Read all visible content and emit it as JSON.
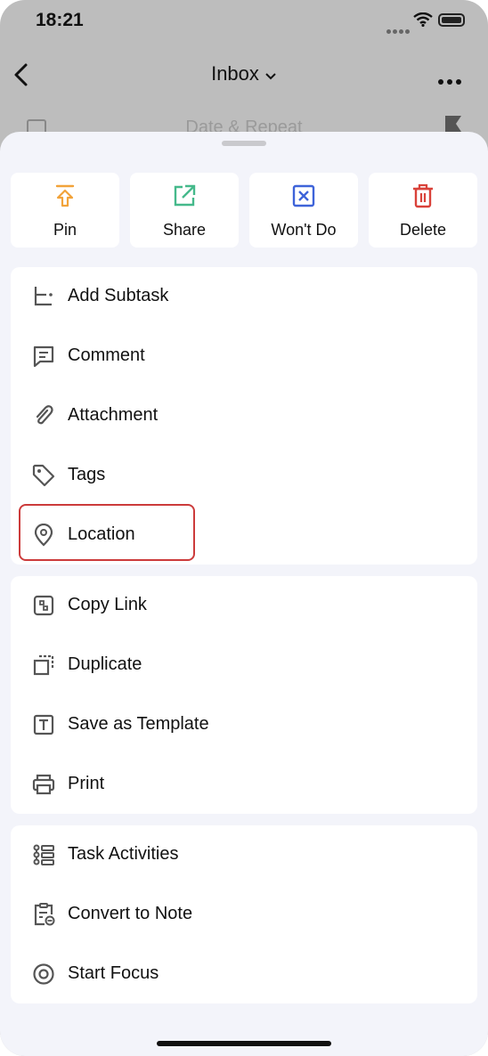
{
  "status_bar": {
    "time": "18:21"
  },
  "nav": {
    "title": "Inbox"
  },
  "background": {
    "row_text": "Date & Repeat"
  },
  "colors": {
    "pin": "#f2a33a",
    "share": "#45b98b",
    "wont_do": "#3e63d9",
    "delete": "#d9423a",
    "highlight": "#cc3b3b"
  },
  "actions": [
    {
      "label": "Pin",
      "icon": "pin-icon"
    },
    {
      "label": "Share",
      "icon": "share-icon"
    },
    {
      "label": "Won't Do",
      "icon": "wont-do-icon"
    },
    {
      "label": "Delete",
      "icon": "trash-icon"
    }
  ],
  "group1": [
    {
      "label": "Add Subtask",
      "icon": "subtask-icon"
    },
    {
      "label": "Comment",
      "icon": "comment-icon"
    },
    {
      "label": "Attachment",
      "icon": "paperclip-icon"
    },
    {
      "label": "Tags",
      "icon": "tag-icon"
    },
    {
      "label": "Location",
      "icon": "location-pin-icon"
    }
  ],
  "group2": [
    {
      "label": "Copy Link",
      "icon": "link-icon"
    },
    {
      "label": "Duplicate",
      "icon": "duplicate-icon"
    },
    {
      "label": "Save as Template",
      "icon": "template-icon"
    },
    {
      "label": "Print",
      "icon": "printer-icon"
    }
  ],
  "group3": [
    {
      "label": "Task Activities",
      "icon": "activities-icon"
    },
    {
      "label": "Convert to Note",
      "icon": "note-icon"
    },
    {
      "label": "Start Focus",
      "icon": "focus-icon"
    }
  ]
}
